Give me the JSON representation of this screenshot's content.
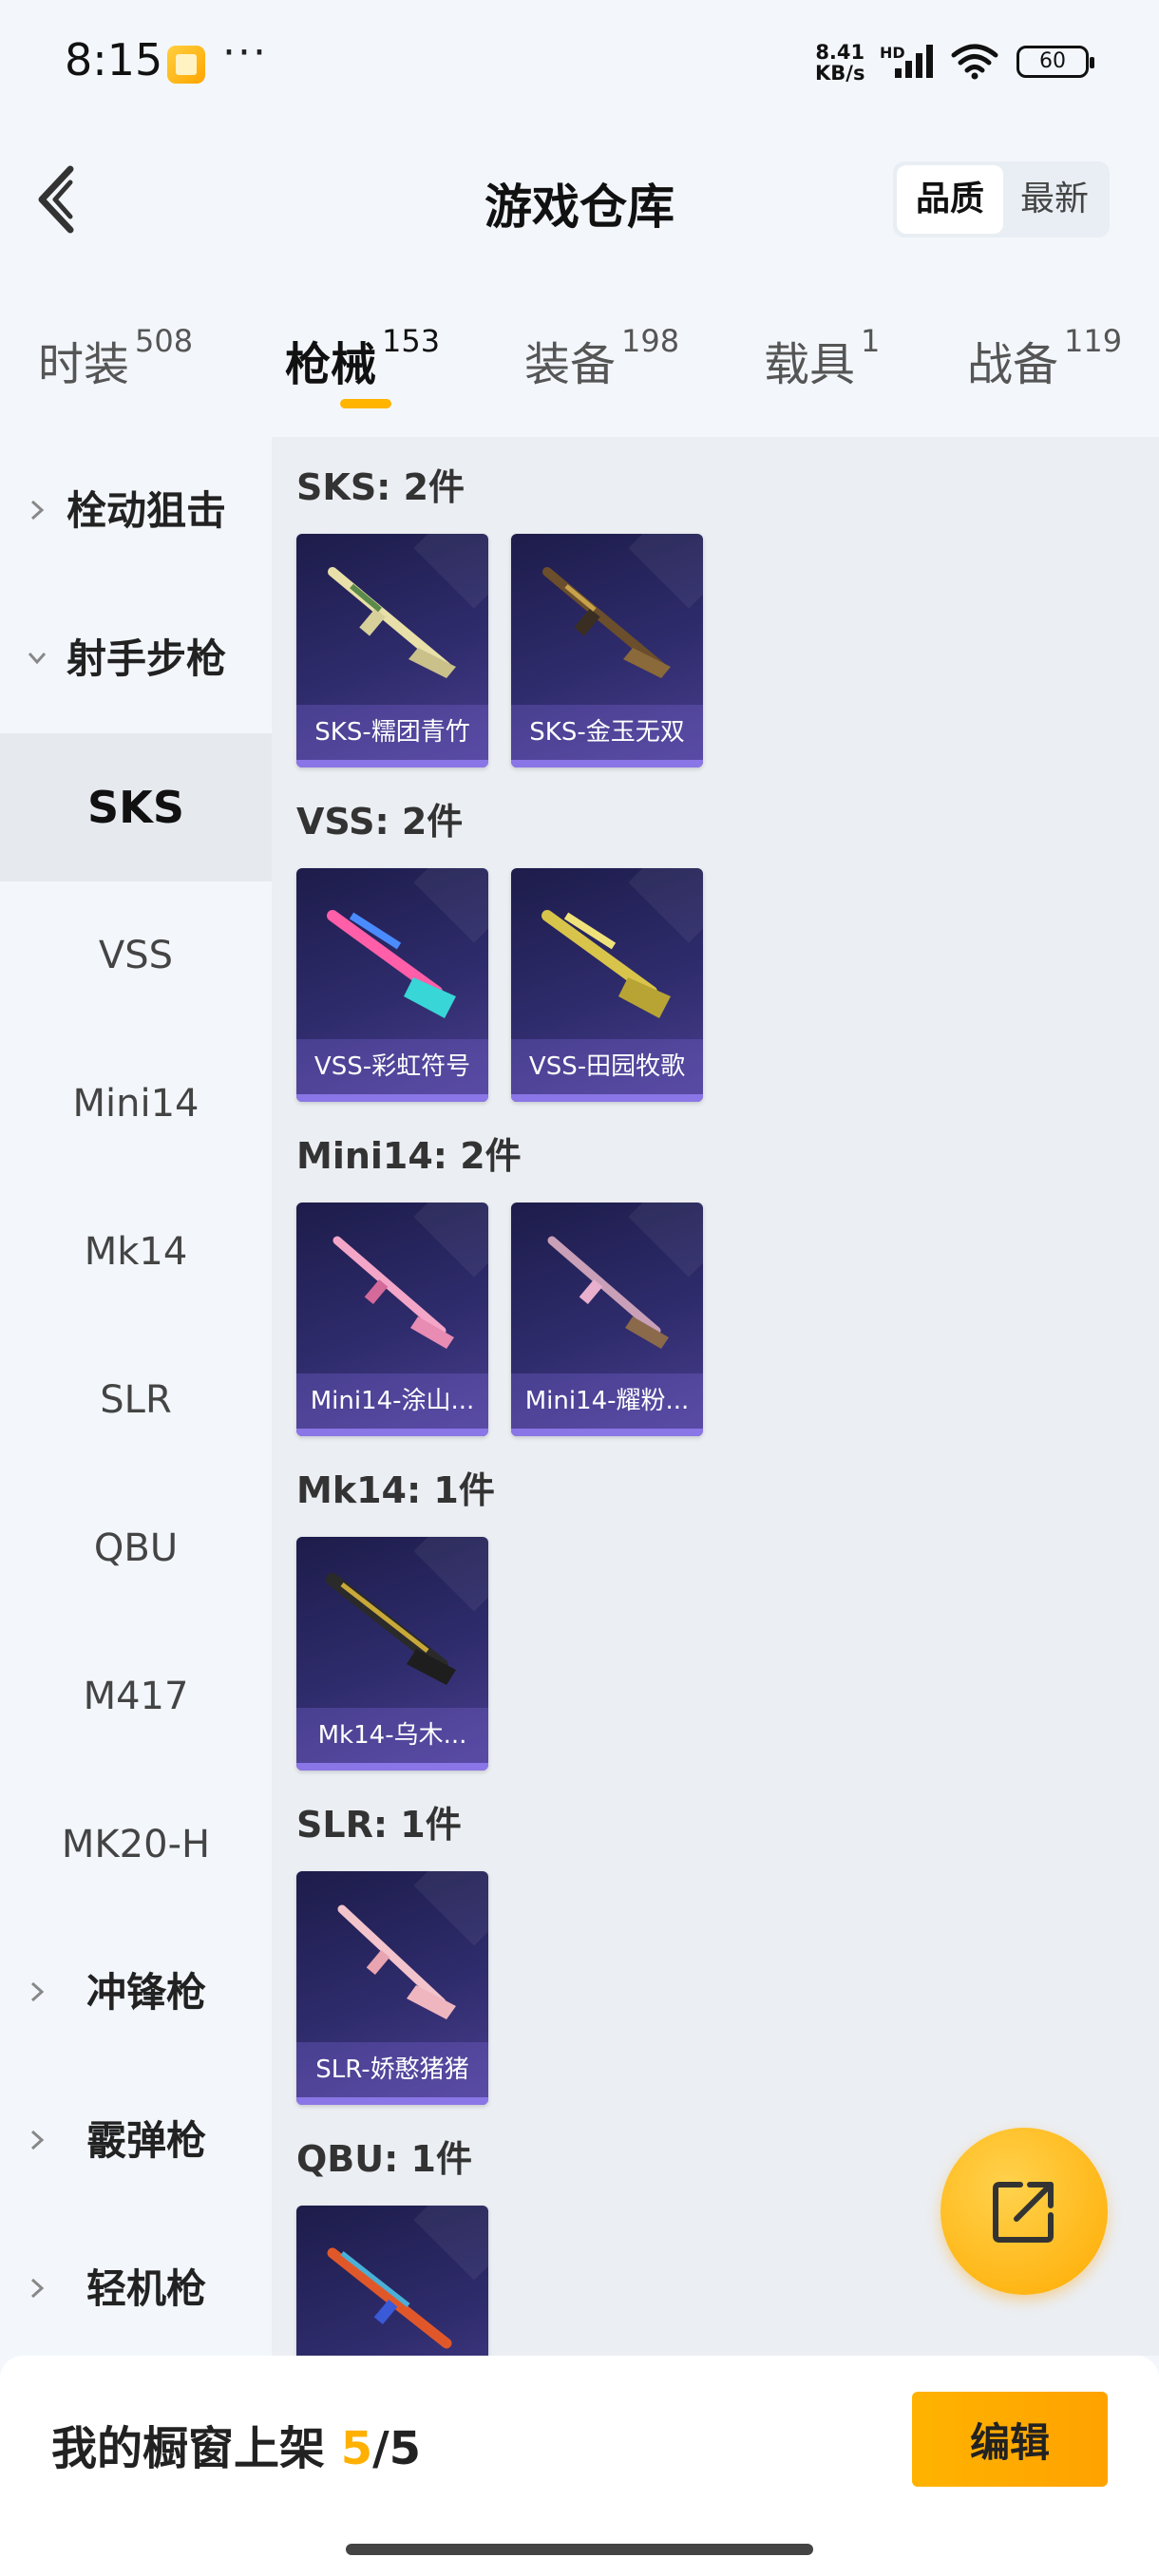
{
  "status_bar": {
    "time": "8:15",
    "dots": "···",
    "net_speed_value": "8.41",
    "net_speed_unit": "KB/s",
    "hd": "HD",
    "battery": "60"
  },
  "header": {
    "title": "游戏仓库",
    "sort_options": [
      "品质",
      "最新"
    ]
  },
  "tabs": [
    {
      "name": "时装",
      "count": "508"
    },
    {
      "name": "枪械",
      "count": "153"
    },
    {
      "name": "装备",
      "count": "198"
    },
    {
      "name": "载具",
      "count": "1"
    },
    {
      "name": "战备",
      "count": "119"
    }
  ],
  "sidebar": {
    "items": [
      "栓动狙击",
      "射手步枪",
      "SKS",
      "VSS",
      "Mini14",
      "Mk14",
      "SLR",
      "QBU",
      "M417",
      "MK20-H",
      "冲锋枪",
      "霰弹枪",
      "轻机枪"
    ]
  },
  "sections": [
    {
      "title": "SKS: 2件",
      "items": [
        "SKS-糯团青竹",
        "SKS-金玉无双"
      ]
    },
    {
      "title": "VSS: 2件",
      "items": [
        "VSS-彩虹符号",
        "VSS-田园牧歌"
      ]
    },
    {
      "title": "Mini14: 2件",
      "items": [
        "Mini14-涂山...",
        "Mini14-耀粉..."
      ]
    },
    {
      "title": "Mk14: 1件",
      "items": [
        "Mk14-乌木..."
      ]
    },
    {
      "title": "SLR: 1件",
      "items": [
        "SLR-娇憨猪猪"
      ]
    },
    {
      "title": "QBU: 1件",
      "items": [
        ""
      ]
    }
  ],
  "bottom": {
    "label": "我的橱窗上架",
    "current": "5",
    "separator": "/",
    "total": "5",
    "edit_label": "编辑"
  },
  "colors": {
    "accent": "#ffb000",
    "card_bg": "#2f2c6d",
    "card_caption_bar": "#8a76e6"
  }
}
